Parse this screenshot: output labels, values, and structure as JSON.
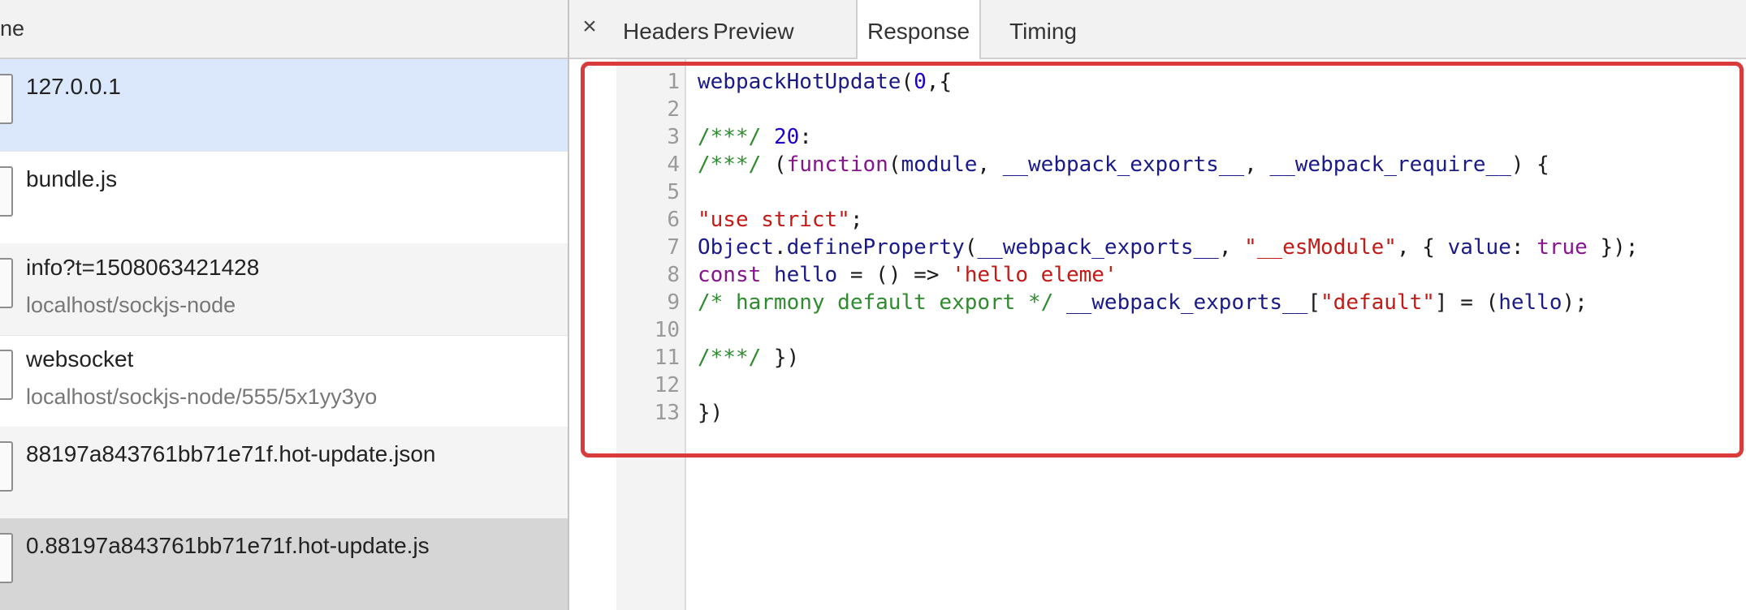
{
  "network_list": {
    "column_header": "ne",
    "requests": [
      {
        "name": "127.0.0.1",
        "sub": "",
        "selected": true
      },
      {
        "name": "bundle.js",
        "sub": ""
      },
      {
        "name": "info?t=1508063421428",
        "sub": "localhost/sockjs-node"
      },
      {
        "name": "websocket",
        "sub": "localhost/sockjs-node/555/5x1yy3yo"
      },
      {
        "name": "88197a843761bb71e71f.hot-update.json",
        "sub": ""
      },
      {
        "name": "0.88197a843761bb71e71f.hot-update.js",
        "sub": ""
      }
    ]
  },
  "details": {
    "close_glyph": "×",
    "tabs": [
      "Headers",
      "Preview",
      "Response",
      "Timing"
    ],
    "active_tab": "Response"
  },
  "response_code": [
    {
      "n": "1",
      "text": "webpackHotUpdate(0,{"
    },
    {
      "n": "2",
      "text": ""
    },
    {
      "n": "3",
      "text": "/***/ 20:"
    },
    {
      "n": "4",
      "text": "/***/ (function(module, __webpack_exports__, __webpack_require__) {"
    },
    {
      "n": "5",
      "text": ""
    },
    {
      "n": "6",
      "text": "\"use strict\";"
    },
    {
      "n": "7",
      "text": "Object.defineProperty(__webpack_exports__, \"__esModule\", { value: true });"
    },
    {
      "n": "8",
      "text": "const hello = () => 'hello eleme'"
    },
    {
      "n": "9",
      "text": "/* harmony default export */ __webpack_exports__[\"default\"] = (hello);"
    },
    {
      "n": "10",
      "text": ""
    },
    {
      "n": "11",
      "text": "/***/ })"
    },
    {
      "n": "12",
      "text": ""
    },
    {
      "n": "13",
      "text": "})"
    }
  ],
  "colors": {
    "selected_row": "#dbe8fb",
    "striped_row": "#f4f4f4",
    "last_row": "#d6d6d6",
    "highlight_border": "#d93a3a"
  }
}
